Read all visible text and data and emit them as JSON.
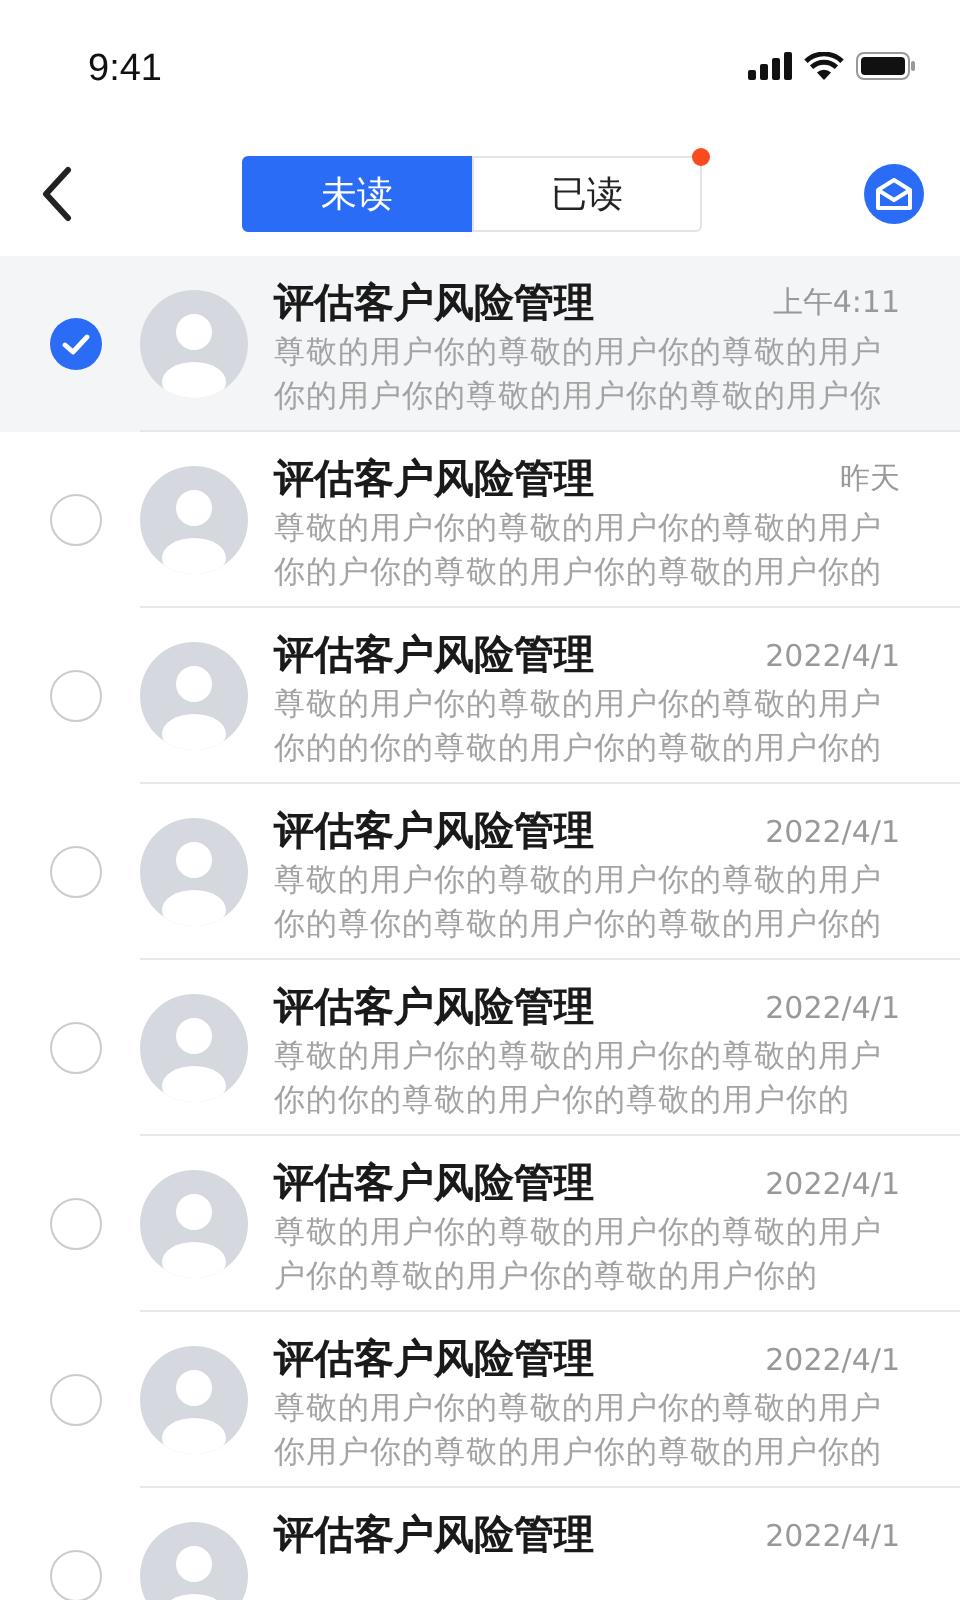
{
  "status_bar": {
    "time": "9:41"
  },
  "tabs": [
    {
      "label": "未读",
      "selected": true,
      "dot": false
    },
    {
      "label": "已读",
      "selected": false,
      "dot": true
    }
  ],
  "messages": [
    {
      "selected": true,
      "title": "评估客户风险管理",
      "time": "上午4:11",
      "preview_lines": [
        "尊敬的用户你的尊敬的用户你的尊敬的用户",
        "你的用户你的尊敬的用户你的尊敬的用户你"
      ]
    },
    {
      "selected": false,
      "title": "评估客户风险管理",
      "time": "昨天",
      "preview_lines": [
        "尊敬的用户你的尊敬的用户你的尊敬的用户",
        "你的户你的尊敬的用户你的尊敬的用户你的"
      ]
    },
    {
      "selected": false,
      "title": "评估客户风险管理",
      "time": "2022/4/1",
      "preview_lines": [
        "尊敬的用户你的尊敬的用户你的尊敬的用户",
        "你的的你的尊敬的用户你的尊敬的用户你的"
      ]
    },
    {
      "selected": false,
      "title": "评估客户风险管理",
      "time": "2022/4/1",
      "preview_lines": [
        "尊敬的用户你的尊敬的用户你的尊敬的用户",
        "你的尊你的尊敬的用户你的尊敬的用户你的"
      ]
    },
    {
      "selected": false,
      "title": "评估客户风险管理",
      "time": "2022/4/1",
      "preview_lines": [
        "尊敬的用户你的尊敬的用户你的尊敬的用户",
        "你的你的尊敬的用户你的尊敬的用户你的"
      ]
    },
    {
      "selected": false,
      "title": "评估客户风险管理",
      "time": "2022/4/1",
      "preview_lines": [
        "尊敬的用户你的尊敬的用户你的尊敬的用户",
        "户你的尊敬的用户你的尊敬的用户你的"
      ]
    },
    {
      "selected": false,
      "title": "评估客户风险管理",
      "time": "2022/4/1",
      "preview_lines": [
        "尊敬的用户你的尊敬的用户你的尊敬的用户",
        "你用户你的尊敬的用户你的尊敬的用户你的"
      ]
    },
    {
      "selected": false,
      "title": "评估客户风险管理",
      "time": "2022/4/1"
    }
  ]
}
